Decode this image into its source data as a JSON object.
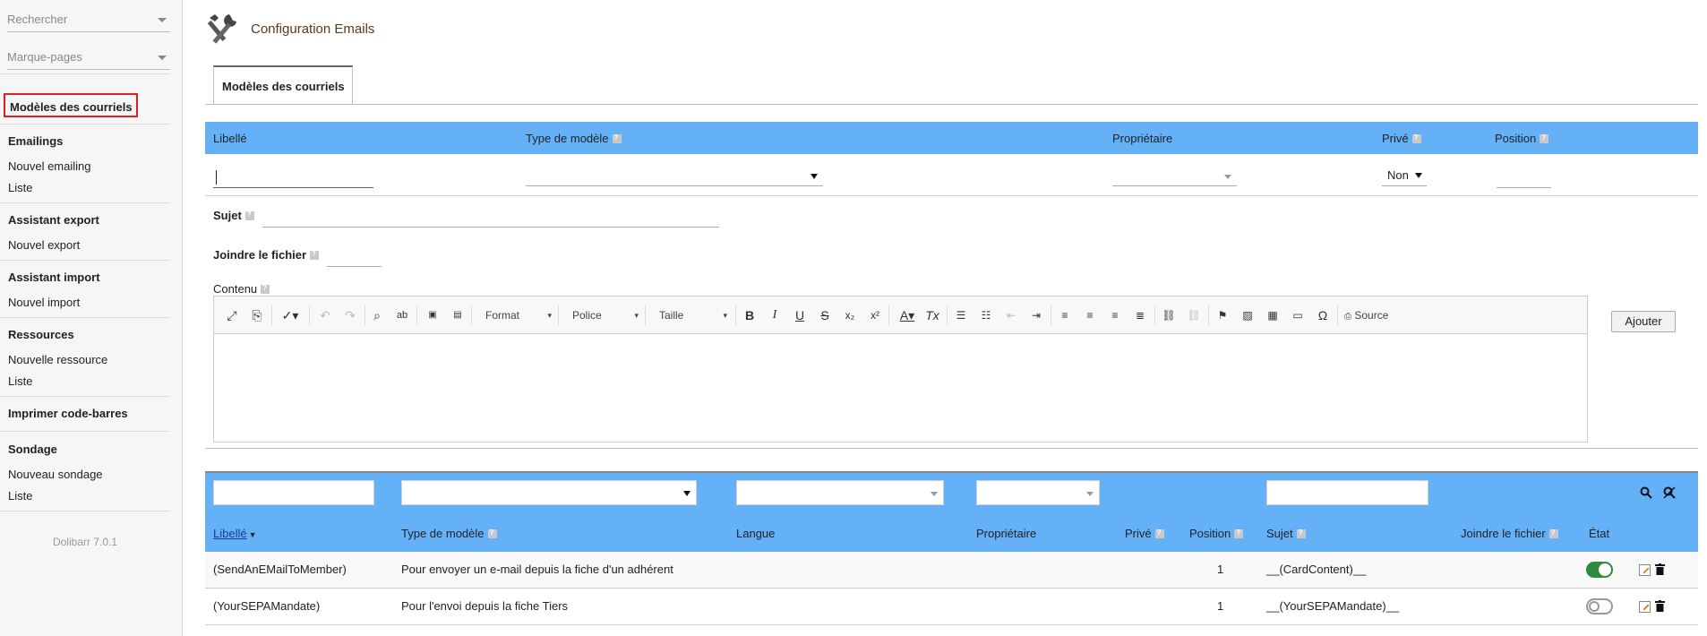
{
  "sidebar": {
    "search_placeholder": "Rechercher",
    "bookmarks_placeholder": "Marque-pages",
    "selected_item": "Modèles des courriels",
    "sections": [
      {
        "title": "Emailings",
        "items": [
          "Nouvel emailing",
          "Liste"
        ]
      },
      {
        "title": "Assistant export",
        "items": [
          "Nouvel export"
        ]
      },
      {
        "title": "Assistant import",
        "items": [
          "Nouvel import"
        ]
      },
      {
        "title": "Ressources",
        "items": [
          "Nouvelle ressource",
          "Liste"
        ]
      },
      {
        "title": "Imprimer code-barres",
        "items": []
      },
      {
        "title": "Sondage",
        "items": [
          "Nouveau sondage",
          "Liste"
        ]
      }
    ],
    "version": "Dolibarr 7.0.1"
  },
  "header": {
    "title": "Configuration Emails",
    "icon": "tools-icon"
  },
  "tabs": [
    {
      "label": "Modèles des courriels",
      "active": true
    }
  ],
  "form": {
    "headers": {
      "libelle": "Libellé",
      "type": "Type de modèle",
      "proprietaire": "Propriétaire",
      "prive": "Privé",
      "position": "Position"
    },
    "prive_value": "Non",
    "sujet_label": "Sujet",
    "joindre_label": "Joindre le fichier",
    "contenu_label": "Contenu",
    "editor": {
      "format_label": "Format",
      "police_label": "Police",
      "taille_label": "Taille",
      "source_label": "Source"
    },
    "add_button": "Ajouter"
  },
  "list": {
    "headers": {
      "libelle": "Libellé",
      "type": "Type de modèle",
      "langue": "Langue",
      "proprietaire": "Propriétaire",
      "prive": "Privé",
      "position": "Position",
      "sujet": "Sujet",
      "joindre": "Joindre le fichier",
      "etat": "État"
    },
    "rows": [
      {
        "libelle": "(SendAnEMailToMember)",
        "type": "Pour envoyer un e-mail depuis la fiche d'un adhérent",
        "position": "1",
        "sujet": "__(CardContent)__",
        "active": true
      },
      {
        "libelle": "(YourSEPAMandate)",
        "type": "Pour l'envoi depuis la fiche Tiers",
        "position": "1",
        "sujet": "__(YourSEPAMandate)__",
        "active": false
      }
    ]
  },
  "colors": {
    "accent": "#64b1f8",
    "toggle_on": "#2e8b3e",
    "title": "#5a3b1c"
  }
}
